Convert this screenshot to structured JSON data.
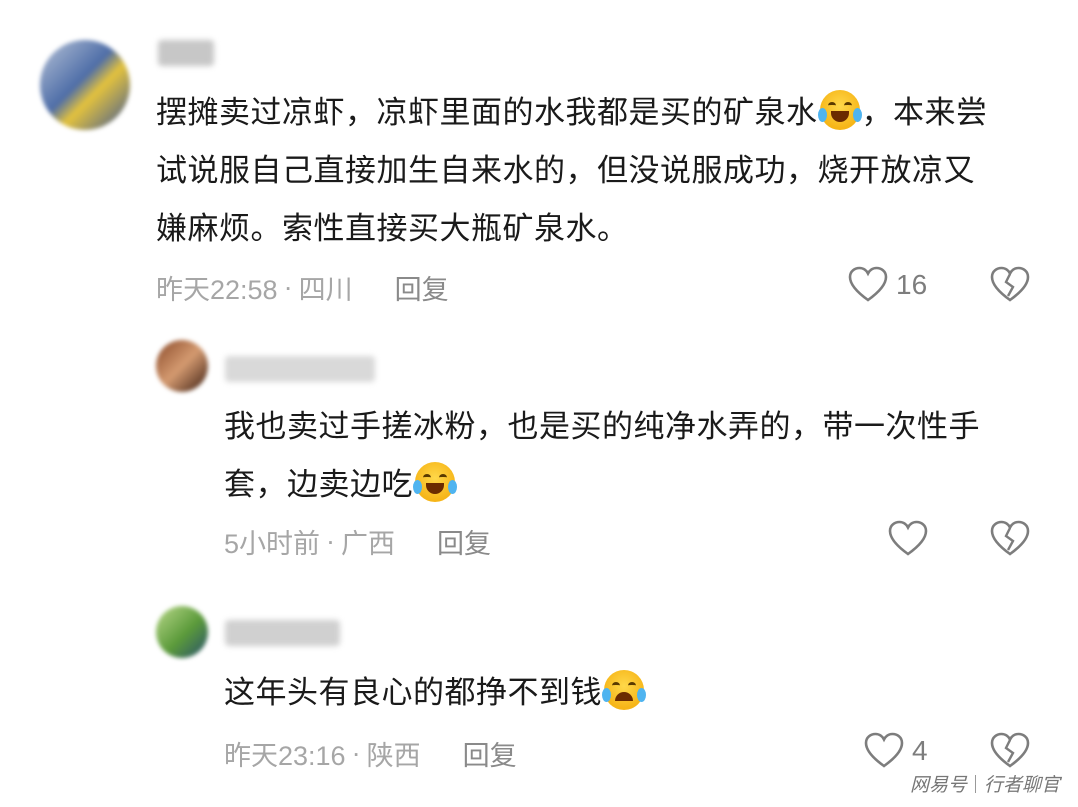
{
  "comments": [
    {
      "text_lines": [
        "摆摊卖过凉虾，凉虾里面的水我都是买的矿泉水",
        "，本来尝",
        "试说服自己直接加生自来水的，但没说服成功，烧开放凉又",
        "嫌麻烦。索性直接买大瓶矿泉水。"
      ],
      "time": "昨天22:58",
      "region": "四川",
      "dot": "·",
      "reply_label": "回复",
      "likes": "16",
      "like_icon": "heart-outline",
      "dislike_icon": "broken-heart-outline"
    },
    {
      "text_lines": [
        "我也卖过手搓冰粉，也是买的纯净水弄的，带一次性手",
        "套，边卖边吃"
      ],
      "time": "5小时前",
      "region": "广西",
      "dot": "·",
      "reply_label": "回复",
      "likes": "",
      "like_icon": "heart-outline",
      "dislike_icon": "broken-heart-outline"
    },
    {
      "text_lines": [
        "这年头有良心的都挣不到钱"
      ],
      "time": "昨天23:16",
      "region": "陕西",
      "dot": "·",
      "reply_label": "回复",
      "likes": "4",
      "like_icon": "heart-outline",
      "dislike_icon": "broken-heart-outline"
    }
  ],
  "watermark": {
    "brand": "网易号",
    "author": "行者聊官"
  },
  "colors": {
    "meta": "#a6a6a6",
    "icon": "#7d7d7d",
    "text": "#1a1a1a"
  }
}
